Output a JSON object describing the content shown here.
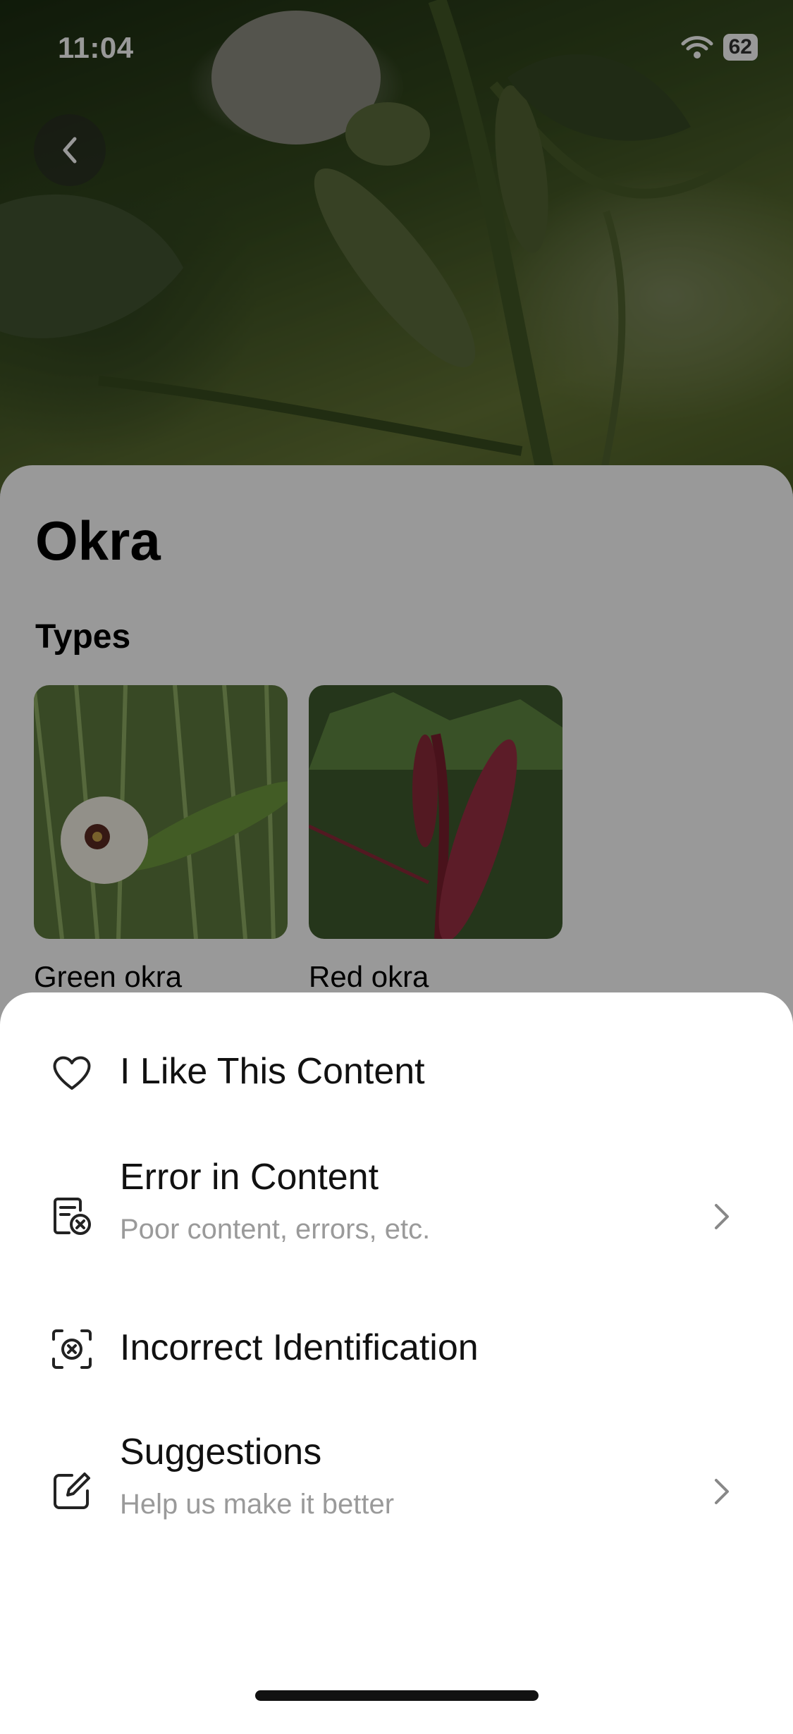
{
  "status_bar": {
    "time": "11:04",
    "battery": "62"
  },
  "header": {
    "back_icon": "chevron-left-icon"
  },
  "plant": {
    "name": "Okra"
  },
  "types_section": {
    "title": "Types",
    "items": [
      {
        "label": "Green okra"
      },
      {
        "label": "Red okra"
      }
    ]
  },
  "feedback_menu": {
    "items": [
      {
        "icon": "heart-icon",
        "title": "I Like This Content",
        "subtitle": ""
      },
      {
        "icon": "document-error-icon",
        "title": "Error in Content",
        "subtitle": "Poor content, errors, etc."
      },
      {
        "icon": "scan-error-icon",
        "title": "Incorrect Identification",
        "subtitle": ""
      },
      {
        "icon": "edit-icon",
        "title": "Suggestions",
        "subtitle": "Help us make it better"
      }
    ]
  }
}
